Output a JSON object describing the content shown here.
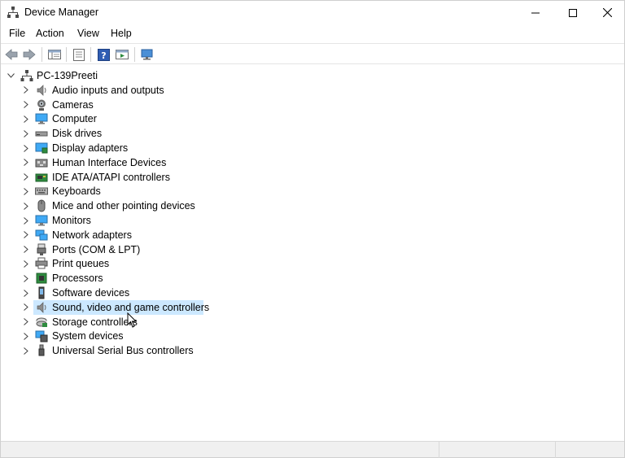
{
  "window": {
    "title": "Device Manager",
    "minimize_label": "",
    "maximize_label": "",
    "close_label": ""
  },
  "menu": {
    "items": [
      {
        "label": "File"
      },
      {
        "label": "Action"
      },
      {
        "label": "View"
      },
      {
        "label": "Help"
      }
    ]
  },
  "toolbar": {
    "buttons": [
      {
        "icon": "back-arrow-icon"
      },
      {
        "icon": "forward-arrow-icon"
      },
      {
        "icon": "show-hide-console-tree-icon"
      },
      {
        "icon": "properties-icon"
      },
      {
        "icon": "help-icon"
      },
      {
        "icon": "run-icon"
      },
      {
        "icon": "scan-hardware-icon"
      }
    ]
  },
  "tree": {
    "root": {
      "label": "PC-139Preeti",
      "icon": "computer-network-icon",
      "expanded": true
    },
    "selected_index": 15,
    "items": [
      {
        "label": "Audio inputs and outputs",
        "icon": "speaker-icon"
      },
      {
        "label": "Cameras",
        "icon": "camera-icon"
      },
      {
        "label": "Computer",
        "icon": "monitor-icon"
      },
      {
        "label": "Disk drives",
        "icon": "disk-drive-icon"
      },
      {
        "label": "Display adapters",
        "icon": "display-adapter-icon"
      },
      {
        "label": "Human Interface Devices",
        "icon": "hid-icon"
      },
      {
        "label": "IDE ATA/ATAPI controllers",
        "icon": "ide-controller-icon"
      },
      {
        "label": "Keyboards",
        "icon": "keyboard-icon"
      },
      {
        "label": "Mice and other pointing devices",
        "icon": "mouse-icon"
      },
      {
        "label": "Monitors",
        "icon": "monitor-icon"
      },
      {
        "label": "Network adapters",
        "icon": "network-adapter-icon"
      },
      {
        "label": "Ports (COM & LPT)",
        "icon": "port-icon"
      },
      {
        "label": "Print queues",
        "icon": "printer-icon"
      },
      {
        "label": "Processors",
        "icon": "processor-icon"
      },
      {
        "label": "Software devices",
        "icon": "software-device-icon"
      },
      {
        "label": "Sound, video and game controllers",
        "icon": "speaker-icon"
      },
      {
        "label": "Storage controllers",
        "icon": "storage-controller-icon"
      },
      {
        "label": "System devices",
        "icon": "system-devices-icon"
      },
      {
        "label": "Universal Serial Bus controllers",
        "icon": "usb-icon"
      }
    ]
  },
  "colors": {
    "selection": "#cce8ff",
    "status_bar": "#f0f0f0"
  }
}
